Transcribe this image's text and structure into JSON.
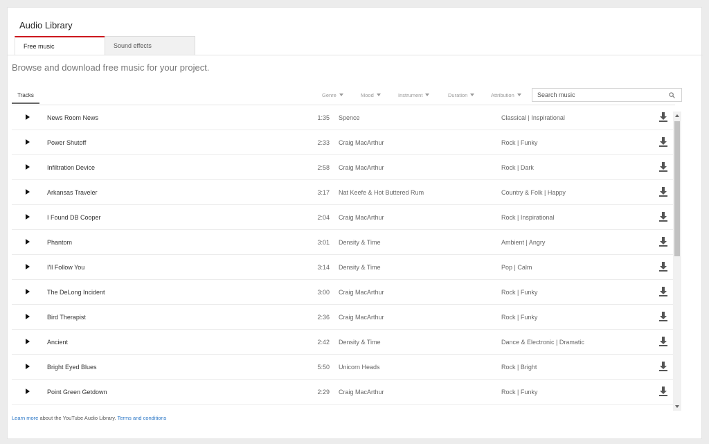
{
  "page": {
    "title": "Audio Library",
    "subtitle": "Browse and download free music for your project."
  },
  "tabs": [
    {
      "label": "Free music"
    },
    {
      "label": "Sound effects"
    }
  ],
  "filters": {
    "tracks_tab": "Tracks",
    "genre": "Genre",
    "mood": "Mood",
    "instrument": "Instrument",
    "duration": "Duration",
    "attribution": "Attribution"
  },
  "search": {
    "placeholder": "Search music",
    "value": ""
  },
  "tracks": [
    {
      "title": "News Room News",
      "duration": "1:35",
      "artist": "Spence",
      "genre": "Classical | Inspirational"
    },
    {
      "title": "Power Shutoff",
      "duration": "2:33",
      "artist": "Craig MacArthur",
      "genre": "Rock | Funky"
    },
    {
      "title": "Infiltration Device",
      "duration": "2:58",
      "artist": "Craig MacArthur",
      "genre": "Rock | Dark"
    },
    {
      "title": "Arkansas Traveler",
      "duration": "3:17",
      "artist": "Nat Keefe & Hot Buttered Rum",
      "genre": "Country & Folk | Happy"
    },
    {
      "title": "I Found DB Cooper",
      "duration": "2:04",
      "artist": "Craig MacArthur",
      "genre": "Rock | Inspirational"
    },
    {
      "title": "Phantom",
      "duration": "3:01",
      "artist": "Density & Time",
      "genre": "Ambient | Angry"
    },
    {
      "title": "I'll Follow You",
      "duration": "3:14",
      "artist": "Density & Time",
      "genre": "Pop | Calm"
    },
    {
      "title": "The DeLong Incident",
      "duration": "3:00",
      "artist": "Craig MacArthur",
      "genre": "Rock | Funky"
    },
    {
      "title": "Bird Therapist",
      "duration": "2:36",
      "artist": "Craig MacArthur",
      "genre": "Rock | Funky"
    },
    {
      "title": "Ancient",
      "duration": "2:42",
      "artist": "Density & Time",
      "genre": "Dance & Electronic | Dramatic"
    },
    {
      "title": "Bright Eyed Blues",
      "duration": "5:50",
      "artist": "Unicorn Heads",
      "genre": "Rock | Bright"
    },
    {
      "title": "Point Green Getdown",
      "duration": "2:29",
      "artist": "Craig MacArthur",
      "genre": "Rock | Funky"
    }
  ],
  "footer": {
    "learn_more": "Learn more",
    "about_text": " about the YouTube Audio Library. ",
    "terms": "Terms and conditions"
  },
  "colors": {
    "accent": "#cc181e",
    "link": "#2a76c6"
  },
  "icons": {
    "play": "play-icon",
    "download": "download-icon",
    "search": "search-icon",
    "dropdown": "caret-down-icon"
  }
}
